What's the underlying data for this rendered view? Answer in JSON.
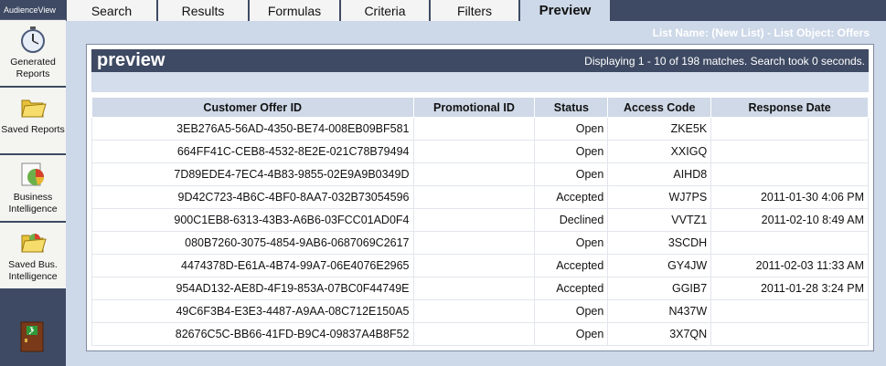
{
  "app": {
    "brand": "AudienceView"
  },
  "sidebar": {
    "items": [
      {
        "label": "Generated Reports"
      },
      {
        "label": "Saved Reports"
      },
      {
        "label": "Business Intelligence"
      },
      {
        "label": "Saved Bus. Intelligence"
      }
    ]
  },
  "tabs": [
    {
      "label": "Search"
    },
    {
      "label": "Results"
    },
    {
      "label": "Formulas"
    },
    {
      "label": "Criteria"
    },
    {
      "label": "Filters"
    },
    {
      "label": "Preview"
    }
  ],
  "list_info": "List Name: (New List) - List Object: Offers",
  "panel": {
    "title": "preview",
    "status": "Displaying 1 - 10 of 198 matches. Search took 0 seconds."
  },
  "table": {
    "columns": [
      "Customer Offer ID",
      "Promotional ID",
      "Status",
      "Access Code",
      "Response Date"
    ],
    "rows": [
      [
        "3EB276A5-56AD-4350-BE74-008EB09BF581",
        "",
        "Open",
        "ZKE5K",
        ""
      ],
      [
        "664FF41C-CEB8-4532-8E2E-021C78B79494",
        "",
        "Open",
        "XXIGQ",
        ""
      ],
      [
        "7D89EDE4-7EC4-4B83-9855-02E9A9B0349D",
        "",
        "Open",
        "AIHD8",
        ""
      ],
      [
        "9D42C723-4B6C-4BF0-8AA7-032B73054596",
        "",
        "Accepted",
        "WJ7PS",
        "2011-01-30 4:06 PM"
      ],
      [
        "900C1EB8-6313-43B3-A6B6-03FCC01AD0F4",
        "",
        "Declined",
        "VVTZ1",
        "2011-02-10 8:49 AM"
      ],
      [
        "080B7260-3075-4854-9AB6-0687069C2617",
        "",
        "Open",
        "3SCDH",
        ""
      ],
      [
        "4474378D-E61A-4B74-99A7-06E4076E2965",
        "",
        "Accepted",
        "GY4JW",
        "2011-02-03 11:33 AM"
      ],
      [
        "954AD132-AE8D-4F19-853A-07BC0F44749E",
        "",
        "Accepted",
        "GGIB7",
        "2011-01-28 3:24 PM"
      ],
      [
        "49C6F3B4-E3E3-4487-A9AA-08C712E150A5",
        "",
        "Open",
        "N437W",
        ""
      ],
      [
        "82676C5C-BB66-41FD-B9C4-09837A4B8F52",
        "",
        "Open",
        "3X7QN",
        ""
      ]
    ]
  },
  "colors": {
    "nav_dark": "#3e4a63",
    "header_light": "#cfd9e7",
    "page_bg": "#cdd8e8"
  }
}
